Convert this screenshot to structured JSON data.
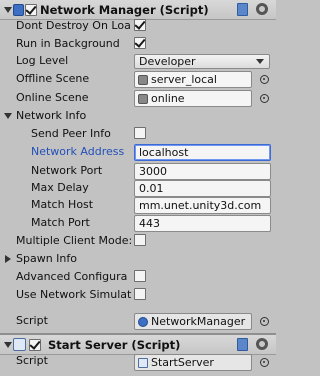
{
  "network_manager": {
    "title": "Network Manager (Script)",
    "enabled": true,
    "props": {
      "dont_destroy": {
        "label": "Dont Destroy On Loa",
        "checked": true
      },
      "run_in_background": {
        "label": "Run in Background",
        "checked": true
      },
      "log_level": {
        "label": "Log Level",
        "value": "Developer"
      },
      "offline_scene": {
        "label": "Offline Scene",
        "value": "server_local"
      },
      "online_scene": {
        "label": "Online Scene",
        "value": "online"
      }
    },
    "network_info": {
      "label": "Network Info",
      "send_peer_info": {
        "label": "Send Peer Info",
        "checked": false
      },
      "network_address": {
        "label": "Network Address",
        "value": "localhost"
      },
      "network_port": {
        "label": "Network Port",
        "value": "3000"
      },
      "max_delay": {
        "label": "Max Delay",
        "value": "0.01"
      },
      "match_host": {
        "label": "Match Host",
        "value": "mm.unet.unity3d.com"
      },
      "match_port": {
        "label": "Match Port",
        "value": "443"
      }
    },
    "multiple_client_mode": {
      "label": "Multiple Client Mode:",
      "checked": false
    },
    "spawn_info": {
      "label": "Spawn Info"
    },
    "advanced_config": {
      "label": "Advanced Configura",
      "checked": false
    },
    "use_network_sim": {
      "label": "Use Network Simulat",
      "checked": false
    },
    "script": {
      "label": "Script",
      "value": "NetworkManager"
    }
  },
  "start_server": {
    "title": "Start Server (Script)",
    "enabled": true,
    "script": {
      "label": "Script",
      "value": "StartServer"
    }
  },
  "colors": {
    "background": "#c2c2c2",
    "focused_label": "#2350b8",
    "focused_field_border": "#3b6ad6"
  },
  "icons": {
    "foldout": "triangle",
    "network_icon": "network-manager-icon",
    "script_icon": "script-icon",
    "help": "help-book-icon",
    "gear": "gear-icon",
    "picker": "object-picker-icon"
  }
}
